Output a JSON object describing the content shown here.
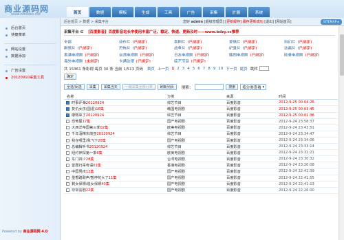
{
  "brand": {
    "logo": "商业源码网",
    "sub": "www.zzcodes.net"
  },
  "nav": [
    "首页",
    "数据",
    "模板",
    "生成",
    "工具",
    "广告",
    "采集",
    "扩展",
    "系统"
  ],
  "nav_active": 0,
  "bar": {
    "crumb": "后台首页 > 数据 > 采集平台",
    "user_prefix": "您好",
    "user": "admin",
    "user_role": "[超级管理员]",
    "links_red": "[更新缓存]  缓存更新成功",
    "links": "[退出]  [网站首页]",
    "sitemap": "SITEMAP ▸"
  },
  "sidebar": {
    "group1": [
      "后台首页",
      "快捷菜单"
    ],
    "group2": [
      "网站设置",
      "数据添加"
    ],
    "group3": [
      "广告设置",
      "20120910采集工具"
    ],
    "active": "20120910采集工具"
  },
  "powered": {
    "label": "Powered by ",
    "name": "商业源码网 4.0"
  },
  "title": {
    "prefix": "采集平台 ∈",
    "notice": "【百度影音】百度影音站长中使用丰富广泛、稳定、快速、更新及时——www.bdzy.cc推荐"
  },
  "categories": [
    {
      "name": "全部",
      "upd": ""
    },
    {
      "name": "动作片",
      "upd": "[已绑定]"
    },
    {
      "name": "喜剧片",
      "upd": "[已绑定]"
    },
    {
      "name": "爱情片",
      "upd": "[已绑定]"
    },
    {
      "name": "科幻片",
      "upd": "[已绑定]"
    },
    {
      "name": "剧情片",
      "upd": "[已绑定]"
    },
    {
      "name": "恐怖片",
      "upd": "[已绑定]"
    },
    {
      "name": "战争片",
      "upd": "[已绑定]"
    },
    {
      "name": "纪录片",
      "upd": "[已绑定]"
    },
    {
      "name": "动画片",
      "upd": "[已绑定]"
    },
    {
      "name": "香港电视剧",
      "upd": "[已绑定]"
    },
    {
      "name": "台湾电视剧",
      "upd": "[已绑定]"
    },
    {
      "name": "日本电视剧",
      "upd": "[已绑定]"
    },
    {
      "name": "韩国电视剧",
      "upd": "[已绑定]"
    },
    {
      "name": "欧美电视剧",
      "upd": "[已绑定]"
    },
    {
      "name": "海外电视剧",
      "upd": "[未绑定]"
    },
    {
      "name": "卡通动漫",
      "upd": "[已绑定]"
    },
    {
      "name": "综艺节目",
      "upd": "[已绑定]"
    }
  ],
  "pager": {
    "summary": "共 15361 条影视 每页 30 条 当前 1/513 页码",
    "first": "首页",
    "prev": "上一页",
    "pages": [
      "1",
      "2",
      "3",
      "4",
      "5",
      "6",
      "7",
      "8",
      "9",
      "10"
    ],
    "current": "1",
    "next": "下一页",
    "last": "尾页",
    "jump": "跳转"
  },
  "buttons": {
    "confirm": "确定",
    "select_all": "全选/反选",
    "collect": "采集",
    "collect_today": "采集当天",
    "collect_all": "一键采集全部分类",
    "refresh": "刷新列页",
    "search": "搜索"
  },
  "search": {
    "placeholder": "",
    "select": "按分类查看"
  },
  "table": {
    "headers": [
      "名称",
      "分类",
      "来源",
      "时间"
    ],
    "rows": [
      {
        "checked": true,
        "title": "时事评弹",
        "num": "20120924",
        "cat": "综艺节目",
        "src": "百度影音",
        "time": "2012-9-25 00:04:26",
        "red": true
      },
      {
        "checked": true,
        "title": "复仇女孩(国语)",
        "num": "16集",
        "cat": "韩国电视剧",
        "src": "百度影音",
        "time": "2012-9-25 00:03:45",
        "red": true
      },
      {
        "checked": true,
        "title": "康熙来了",
        "num": "20120924",
        "cat": "综艺节目",
        "src": "百度影音",
        "time": "2012-9-25 00:01:36",
        "red": true
      },
      {
        "checked": false,
        "title": "恐怖屋",
        "num": "17集",
        "cat": "国产电视剧",
        "src": "百度影音",
        "time": "2012-9-24 23:58:37",
        "red": false
      },
      {
        "checked": false,
        "title": "大西洋帝国第三季",
        "num": "02集",
        "cat": "欧美电视剧",
        "src": "百度影音",
        "time": "2012-9-24 23:43:51",
        "red": false
      },
      {
        "checked": false,
        "title": "千年酒精东南亚",
        "num": "20120924",
        "cat": "综艺节目",
        "src": "百度影音",
        "time": "2012-9-24 23:34:47",
        "red": false
      },
      {
        "checked": false,
        "title": "我在哪里/我飞下",
        "num": "20集",
        "cat": "国产电视剧",
        "src": "百度影音",
        "time": "2012-9-24 23:34:06",
        "red": false
      },
      {
        "checked": false,
        "title": "总编辑听书",
        "num": "20120924",
        "cat": "综艺节目",
        "src": "百度影音",
        "time": "2012-9-24 23:33:14",
        "red": false
      },
      {
        "checked": false,
        "title": "纽约神探第一季",
        "num": "6集",
        "cat": "欧美电视剧",
        "src": "百度影音",
        "time": "2012-9-24 23:32:21",
        "red": false
      },
      {
        "checked": false,
        "title": "东门四少",
        "num": "28集",
        "cat": "台湾电视剧",
        "src": "百度影音",
        "time": "2012-9-24 23:30:32",
        "red": false
      },
      {
        "checked": false,
        "title": "雷霆扫毒粤语",
        "num": "01集",
        "cat": "香港电视剧",
        "src": "百度影音",
        "time": "2012-9-24 23:20:08",
        "red": false
      },
      {
        "checked": false,
        "title": "中国男孩",
        "num": "12集",
        "cat": "国产电视剧",
        "src": "百度影音",
        "time": "2012-9-24 22:42:39",
        "red": false
      },
      {
        "checked": false,
        "title": "墨香踏歌声/暂停花大了",
        "num": "11集",
        "cat": "国产电视剧",
        "src": "百度影音",
        "time": "2012-9-24 22:41:55",
        "red": false
      },
      {
        "checked": false,
        "title": "剩女保镖/追女保镖",
        "num": "40集",
        "cat": "国产电视剧",
        "src": "百度影音",
        "time": "2012-9-24 22:41:13",
        "red": false
      },
      {
        "checked": false,
        "title": "非常喜剧",
        "num": "22集",
        "cat": "国产电视剧",
        "src": "百度影音",
        "time": "2012-9-24 22:26:00",
        "red": false
      }
    ]
  }
}
